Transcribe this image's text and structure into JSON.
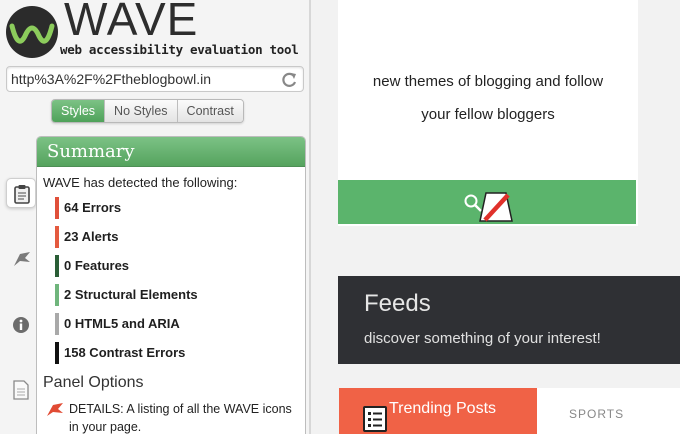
{
  "wave": {
    "logo_text": "WAVE",
    "subtitle": "web accessibility evaluation tool",
    "url": "http%3A%2F%2Ftheblogbowl.in",
    "view_buttons": [
      {
        "label": "Styles",
        "active": true
      },
      {
        "label": "No Styles",
        "active": false
      },
      {
        "label": "Contrast",
        "active": false
      }
    ],
    "side_tabs": [
      {
        "icon": "clipboard-icon"
      },
      {
        "icon": "flag-icon"
      },
      {
        "icon": "info-icon"
      },
      {
        "icon": "document-icon"
      }
    ],
    "summary": {
      "title": "Summary",
      "intro": "WAVE has detected the following:",
      "items": [
        {
          "label": "64 Errors",
          "color": "#e0503a"
        },
        {
          "label": "23 Alerts",
          "color": "#e45a3f"
        },
        {
          "label": "0 Features",
          "color": "#2a5e36"
        },
        {
          "label": "2 Structural Elements",
          "color": "#6fb57c"
        },
        {
          "label": "0 HTML5 and ARIA",
          "color": "#a9a9a9"
        },
        {
          "label": "158 Contrast Errors",
          "color": "#111111"
        }
      ]
    },
    "panel_options": {
      "title": "Panel Options",
      "details_text": "DETAILS: A listing of all the WAVE icons in your page."
    }
  },
  "page": {
    "top_text_line1": "new themes of blogging and follow",
    "top_text_line2": "your fellow bloggers",
    "feeds_title": "Feeds",
    "feeds_subtitle": "discover something of your interest!",
    "trending_label": "Trending Posts",
    "sports_label": "SPORTS",
    "colors": {
      "search_bar": "#5bb46c",
      "feeds_bg": "#2f3034",
      "trending_bg": "#f06246"
    }
  }
}
